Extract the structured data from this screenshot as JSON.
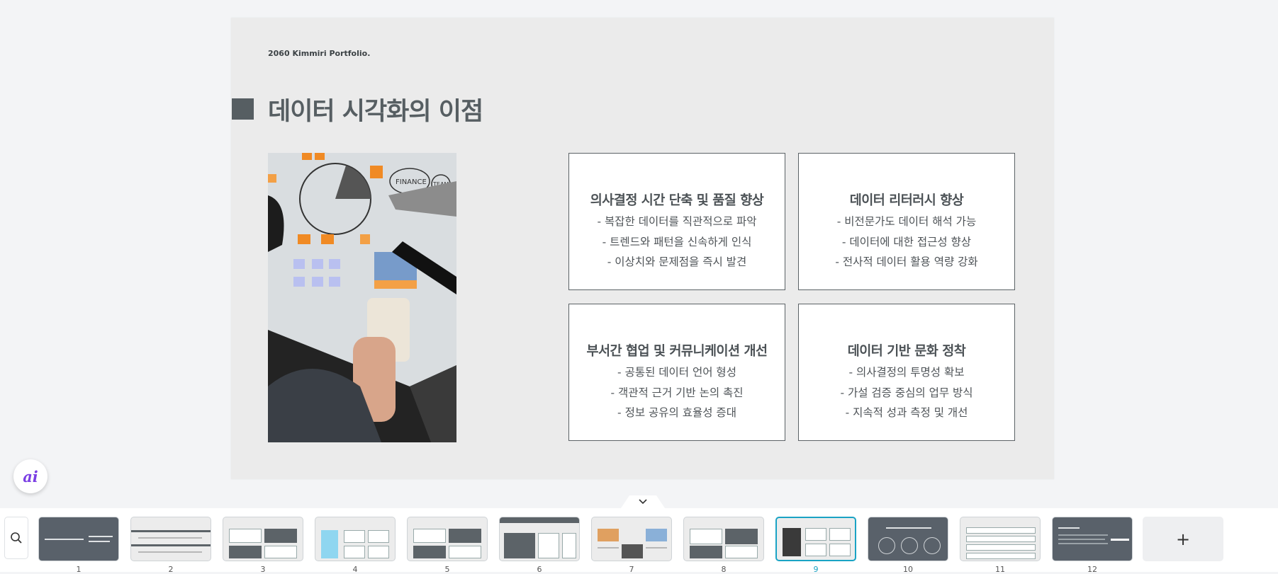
{
  "slide": {
    "header": "2060 Kimmiri Portfolio.",
    "title": "데이터 시각화의 이점",
    "cards": [
      {
        "heading": "의사결정 시간 단축 및 품질 향상",
        "lines": [
          "- 복잡한 데이터를 직관적으로 파악",
          "- 트렌드와 패턴을 신속하게 인식",
          "- 이상치와 문제점을 즉시 발견"
        ]
      },
      {
        "heading": "데이터 리터러시 향상",
        "lines": [
          "- 비전문가도 데이터 해석 가능",
          "- 데이터에 대한 접근성 향상",
          "- 전사적 데이터 활용 역량 강화"
        ]
      },
      {
        "heading": "부서간 협업 및 커뮤니케이션 개선",
        "lines": [
          "- 공통된 데이터 언어 형성",
          "- 객관적 근거 기반 논의 촉진",
          "- 정보 공유의 효율성 증대"
        ]
      },
      {
        "heading": "데이터 기반 문화 정착",
        "lines": [
          "- 의사결정의 투명성 확보",
          "- 가설 검증 중심의 업무 방식",
          "- 지속적 성과 측정 및 개선"
        ]
      }
    ],
    "photo_whiteboard_labels": [
      "FINANCE",
      "TEAM"
    ]
  },
  "ai_button": {
    "label": "ai"
  },
  "collapse_icon": "chevron-down-icon",
  "search_icon": "search-icon",
  "add_slide": {
    "label": "+"
  },
  "thumbnails": [
    {
      "number": "1"
    },
    {
      "number": "2"
    },
    {
      "number": "3"
    },
    {
      "number": "4"
    },
    {
      "number": "5"
    },
    {
      "number": "6"
    },
    {
      "number": "7"
    },
    {
      "number": "8"
    },
    {
      "number": "9"
    },
    {
      "number": "10"
    },
    {
      "number": "11"
    },
    {
      "number": "12"
    }
  ],
  "selected_thumbnail": "9",
  "colors": {
    "accent": "#1aa3c4",
    "slide_dark": "#565e62",
    "slide_bg": "#ebebeb"
  }
}
